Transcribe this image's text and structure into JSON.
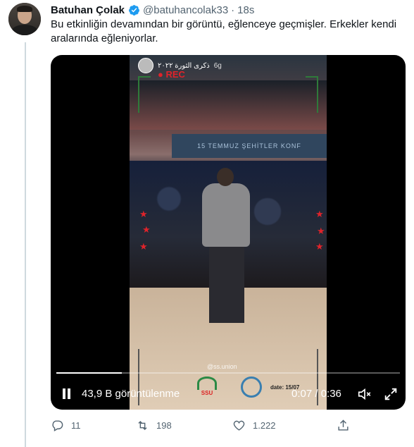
{
  "tweet": {
    "author_name": "Batuhan Çolak",
    "handle": "@batuhancolak33",
    "separator": "·",
    "time": "18s",
    "text": "Bu etkinliğin devamından bir görüntü, eğlenceye geçmişler. Erkekler kendi aralarında eğleniyorlar."
  },
  "video": {
    "story_label": "ذكرى الثورة ٢٠٢٢",
    "story_time": "6g",
    "rec_label": "● REC",
    "banner_text": "15 TEMMUZ ŞEHİTLER KONF",
    "watermark": "@ss.union",
    "logo_label": "SSU",
    "date_stamp": "date: 15/07",
    "progress_fraction": 0.19,
    "views_label": "43,9 B görüntülenme",
    "time_label": "0:07 / 0:36"
  },
  "actions": {
    "reply_count": "11",
    "retweet_count": "198",
    "like_count": "1.222"
  },
  "icons": {
    "verified": "verified-badge-icon",
    "pause": "pause-icon",
    "mute": "volume-muted-icon",
    "fullscreen": "fullscreen-icon",
    "reply": "reply-icon",
    "retweet": "retweet-icon",
    "like": "heart-icon",
    "share": "share-icon"
  },
  "colors": {
    "verified": "#1d9bf0",
    "text_primary": "#0f1419",
    "text_secondary": "#536471",
    "rec": "#e0232a"
  }
}
